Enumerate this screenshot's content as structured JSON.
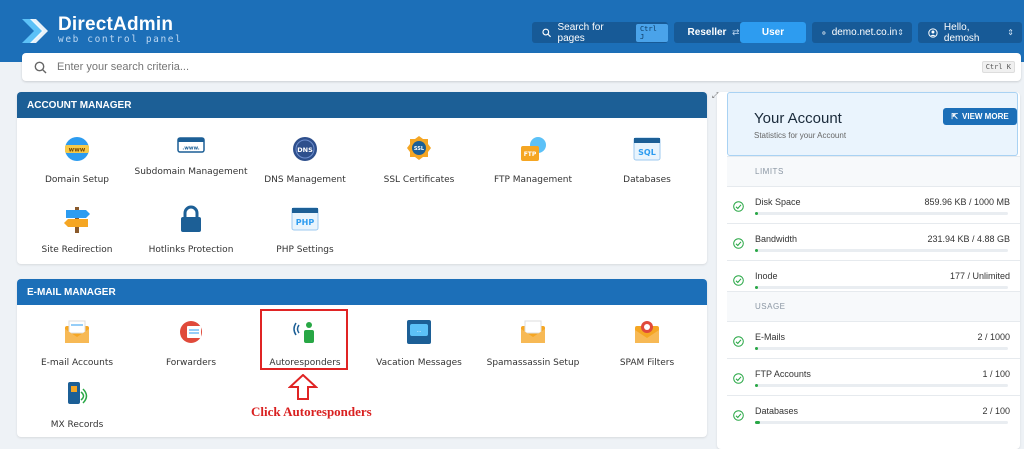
{
  "header": {
    "logo_title": "DirectAdmin",
    "logo_sub": "web control panel",
    "search_pages": "Search for pages",
    "search_kbd": "Ctrl J",
    "reseller": "Reseller",
    "user": "User",
    "domain": "demo.net.co.in",
    "hello": "Hello, demosh",
    "colors": {
      "bar": "#1c6fb8",
      "accent": "#2d9cf0"
    }
  },
  "search": {
    "placeholder": "Enter your search criteria...",
    "kbd": "Ctrl K"
  },
  "account_manager": {
    "title": "ACCOUNT MANAGER",
    "items": [
      {
        "label": "Domain Setup",
        "icon": "www-globe-icon"
      },
      {
        "label": "Subdomain Management",
        "icon": "subdomain-icon"
      },
      {
        "label": "DNS Management",
        "icon": "dns-icon"
      },
      {
        "label": "SSL Certificates",
        "icon": "ssl-badge-icon"
      },
      {
        "label": "FTP Management",
        "icon": "ftp-icon"
      },
      {
        "label": "Databases",
        "icon": "sql-icon"
      },
      {
        "label": "Site Redirection",
        "icon": "signpost-icon"
      },
      {
        "label": "Hotlinks Protection",
        "icon": "lock-icon"
      },
      {
        "label": "PHP Settings",
        "icon": "php-icon"
      }
    ]
  },
  "email_manager": {
    "title": "E-MAIL MANAGER",
    "items": [
      {
        "label": "E-mail Accounts",
        "icon": "mail-accounts-icon"
      },
      {
        "label": "Forwarders",
        "icon": "forwarder-icon"
      },
      {
        "label": "Autoresponders",
        "icon": "autoresponder-icon"
      },
      {
        "label": "Vacation Messages",
        "icon": "vacation-icon"
      },
      {
        "label": "Spamassassin Setup",
        "icon": "spamassassin-icon"
      },
      {
        "label": "SPAM Filters",
        "icon": "spam-filter-icon"
      },
      {
        "label": "MX Records",
        "icon": "mx-records-icon"
      }
    ]
  },
  "annotation": {
    "text": "Click Autoresponders"
  },
  "account": {
    "title": "Your Account",
    "subtitle": "Statistics for your Account",
    "view_more": "VIEW MORE",
    "limits_label": "LIMITS",
    "usage_label": "USAGE",
    "limits": [
      {
        "name": "Disk Space",
        "value": "859.96 KB / 1000 MB",
        "fraction": 0.001
      },
      {
        "name": "Bandwidth",
        "value": "231.94 KB / 4.88 GB",
        "fraction": 0.0
      },
      {
        "name": "Inode",
        "value": "177 / Unlimited",
        "fraction": 0.0
      }
    ],
    "usage": [
      {
        "name": "E-Mails",
        "value": "2 / 1000",
        "fraction": 0.002
      },
      {
        "name": "FTP Accounts",
        "value": "1 / 100",
        "fraction": 0.01
      },
      {
        "name": "Databases",
        "value": "2 / 100",
        "fraction": 0.02
      }
    ]
  }
}
